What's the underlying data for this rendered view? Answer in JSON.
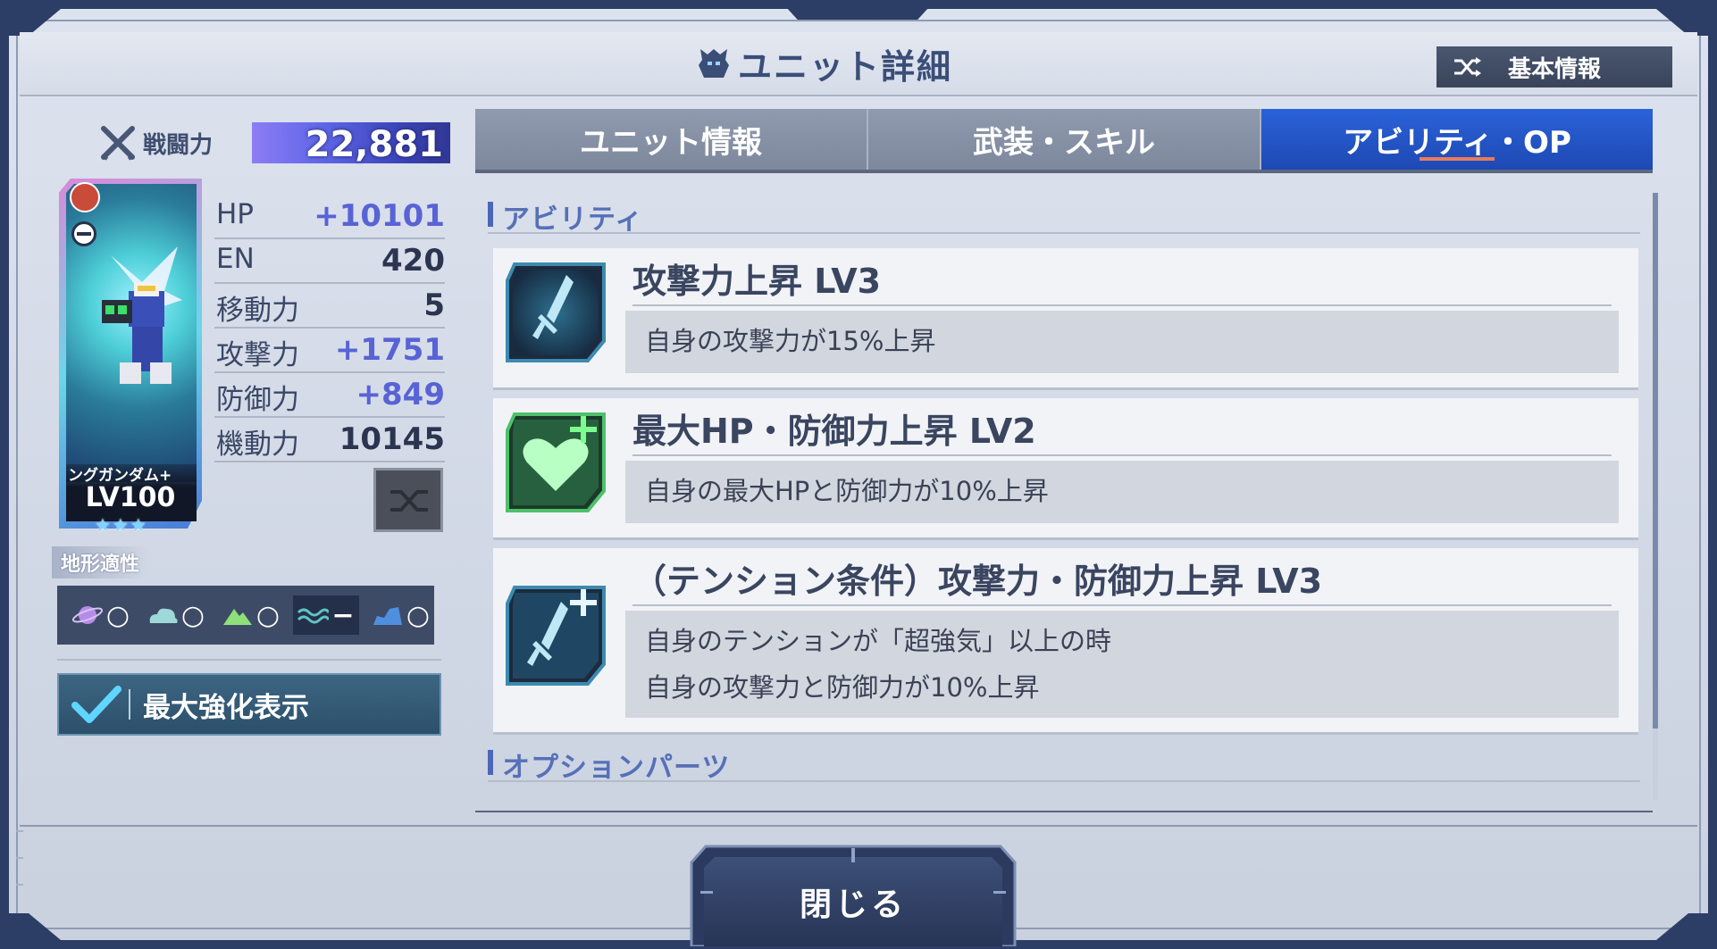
{
  "header": {
    "title": "ユニット詳細",
    "basic_info_label": "基本情報"
  },
  "power": {
    "label": "戦闘力",
    "value": "22,881"
  },
  "unit": {
    "name": "ングガンダム+",
    "level": "LV100",
    "stars": "★★★"
  },
  "stats": [
    {
      "label": "HP",
      "value": "+10101",
      "boosted": true
    },
    {
      "label": "EN",
      "value": "420",
      "boosted": false
    },
    {
      "label": "移動力",
      "value": "5",
      "boosted": false
    },
    {
      "label": "攻撃力",
      "value": "+1751",
      "boosted": true
    },
    {
      "label": "防御力",
      "value": "+849",
      "boosted": true
    },
    {
      "label": "機動力",
      "value": "10145",
      "boosted": false
    }
  ],
  "terrain": {
    "label": "地形適性",
    "items": [
      {
        "icon": "space-planet-icon",
        "grade": "○"
      },
      {
        "icon": "air-cloud-icon",
        "grade": "○"
      },
      {
        "icon": "ground-mountain-icon",
        "grade": "○"
      },
      {
        "icon": "water-wave-icon",
        "grade": "−"
      },
      {
        "icon": "land-terrain-icon",
        "grade": "○"
      }
    ]
  },
  "max_enhance": {
    "label": "最大強化表示",
    "checked": true
  },
  "tabs": [
    {
      "label": "ユニット情報",
      "active": false
    },
    {
      "label": "武装・スキル",
      "active": false
    },
    {
      "label": "アビリティ・OP",
      "active": true
    }
  ],
  "abilities_section": {
    "title": "アビリティ",
    "items": [
      {
        "name": "攻撃力上昇 LV3",
        "icon": "sword-icon",
        "desc": [
          "自身の攻撃力が15%上昇"
        ]
      },
      {
        "name": "最大HP・防御力上昇 LV2",
        "icon": "heart-plus-icon",
        "desc": [
          "自身の最大HPと防御力が10%上昇"
        ]
      },
      {
        "name": "（テンション条件）攻撃力・防御力上昇 LV3",
        "icon": "sword-plus-icon",
        "desc": [
          "自身のテンションが「超強気」以上の時",
          "自身の攻撃力と防御力が10%上昇"
        ]
      }
    ]
  },
  "options_section": {
    "title": "オプションパーツ"
  },
  "close_label": "閉じる",
  "colors": {
    "accent_blue": "#1d49b4",
    "boost_text": "#5863d6",
    "frame": "#2c3d66"
  }
}
